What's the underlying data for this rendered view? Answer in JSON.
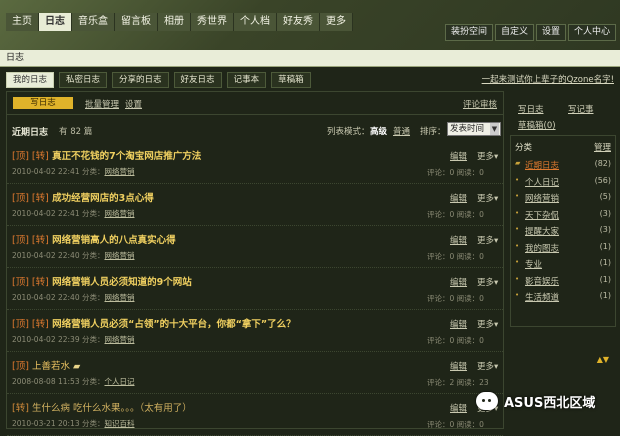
{
  "nav": {
    "items": [
      "主页",
      "日志",
      "音乐盒",
      "留言板",
      "相册",
      "秀世界",
      "个人档",
      "好友秀",
      "更多"
    ],
    "active_index": 1
  },
  "right_nav": [
    "装扮空间",
    "自定义",
    "设置",
    "个人中心"
  ],
  "page_title": "日志",
  "tabs": [
    "我的日志",
    "私密日志",
    "分享的日志",
    "好友日志",
    "记事本",
    "草稿箱"
  ],
  "active_tab": 0,
  "qzone_link": "一起来测试你上辈子的Qzone名字!",
  "toolbar": {
    "write_label": "写日志",
    "batch_label": "批量管理",
    "setting_label": "设置",
    "comment_review_label": "评论审核"
  },
  "list_header": {
    "recent_label": "近期日志",
    "count_text": "有 82 篇",
    "list_mode_label": "列表模式：",
    "mode_advanced": "高级",
    "mode_normal": "普通",
    "sort_label": "排序：",
    "sort_value": "发表时间"
  },
  "posts": [
    {
      "prefix": "[顶] [转]",
      "title": "真正不花钱的7个淘宝网店推广方法",
      "date": "2010-04-02 22:41",
      "cat_label": "分类：",
      "category": "网络营销",
      "edit": "编辑",
      "more": "更多▾",
      "stats": "评论：0   阅读：0"
    },
    {
      "prefix": "[顶] [转]",
      "title": "成功经营网店的3点心得",
      "date": "2010-04-02 22:41",
      "cat_label": "分类：",
      "category": "网络营销",
      "edit": "编辑",
      "more": "更多▾",
      "stats": "评论：0   阅读：0"
    },
    {
      "prefix": "[顶] [转]",
      "title": "网络营销高人的八点真实心得",
      "date": "2010-04-02 22:40",
      "cat_label": "分类：",
      "category": "网络营销",
      "edit": "编辑",
      "more": "更多▾",
      "stats": "评论：0   阅读：0"
    },
    {
      "prefix": "[顶] [转]",
      "title": "网络营销人员必须知道的9个网站",
      "date": "2010-04-02 22:40",
      "cat_label": "分类：",
      "category": "网络营销",
      "edit": "编辑",
      "more": "更多▾",
      "stats": "评论：0   阅读：0"
    },
    {
      "prefix": "[顶] [转]",
      "title": "网络营销人员必须“占领”的十大平台，你都“拿下”了么？",
      "date": "2010-04-02 22:39",
      "cat_label": "分类：",
      "category": "网络营销",
      "edit": "编辑",
      "more": "更多▾",
      "stats": "评论：0   阅读：0"
    },
    {
      "prefix": "[顶]",
      "title": "上善若水",
      "date": "2008-08-08 11:53",
      "cat_label": "分类：",
      "category": "个人日记",
      "edit": "编辑",
      "more": "更多▾",
      "stats": "评论：2   阅读：23"
    },
    {
      "prefix": "[转]",
      "title": "生什么病 吃什么水果。。。（太有用了）",
      "date": "2010-03-21 20:13",
      "cat_label": "分类：",
      "category": "知识百科",
      "edit": "编辑",
      "more": "更多▾",
      "stats": "评论：0   阅读：0"
    }
  ],
  "sidebar": {
    "write_label": "写日志",
    "notebook_label": "写记事",
    "draft_label": "草稿箱(0)",
    "category_header": "分类",
    "manage_label": "管理",
    "categories": [
      {
        "name": "近期日志",
        "count": "(82)"
      },
      {
        "name": "个人日记",
        "count": "(56)"
      },
      {
        "name": "网络营销",
        "count": "(5)"
      },
      {
        "name": "天下杂侃",
        "count": "(3)"
      },
      {
        "name": "提醒大家",
        "count": "(3)"
      },
      {
        "name": "我的图志",
        "count": "(1)"
      },
      {
        "name": "专业",
        "count": "(1)"
      },
      {
        "name": "影音娱乐",
        "count": "(1)"
      },
      {
        "name": "生活频道",
        "count": "(1)"
      }
    ],
    "pager": "▲▼"
  },
  "watermark": "ASUS西北区域",
  "colors": {
    "background": "#1f2518",
    "accent_orange": "#e07a2f",
    "accent_gold": "#e0b32a",
    "title_yellow": "#f0d060"
  }
}
